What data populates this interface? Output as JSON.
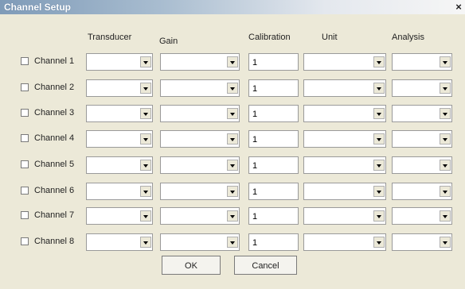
{
  "window": {
    "title": "Channel Setup",
    "close_glyph": "×"
  },
  "columns": {
    "transducer": "Transducer",
    "gain": "Gain",
    "calibration": "Calibration",
    "unit": "Unit",
    "analysis": "Analysis"
  },
  "channels": [
    {
      "label": "Channel 1",
      "checked": false,
      "transducer": "",
      "gain": "",
      "calibration": "1",
      "unit": "",
      "analysis": ""
    },
    {
      "label": "Channel 2",
      "checked": false,
      "transducer": "",
      "gain": "",
      "calibration": "1",
      "unit": "",
      "analysis": ""
    },
    {
      "label": "Channel 3",
      "checked": false,
      "transducer": "",
      "gain": "",
      "calibration": "1",
      "unit": "",
      "analysis": ""
    },
    {
      "label": "Channel 4",
      "checked": false,
      "transducer": "",
      "gain": "",
      "calibration": "1",
      "unit": "",
      "analysis": ""
    },
    {
      "label": "Channel 5",
      "checked": false,
      "transducer": "",
      "gain": "",
      "calibration": "1",
      "unit": "",
      "analysis": ""
    },
    {
      "label": "Channel 6",
      "checked": false,
      "transducer": "",
      "gain": "",
      "calibration": "1",
      "unit": "",
      "analysis": ""
    },
    {
      "label": "Channel 7",
      "checked": false,
      "transducer": "",
      "gain": "",
      "calibration": "1",
      "unit": "",
      "analysis": ""
    },
    {
      "label": "Channel 8",
      "checked": false,
      "transducer": "",
      "gain": "",
      "calibration": "1",
      "unit": "",
      "analysis": ""
    }
  ],
  "buttons": {
    "ok": "OK",
    "cancel": "Cancel"
  },
  "icons": {
    "dropdown": "chevron-down-icon",
    "close": "close-icon"
  },
  "colors": {
    "dialog_bg": "#ECE9D8",
    "titlebar_start": "#7f9bb8",
    "field_bg": "#ffffff"
  }
}
